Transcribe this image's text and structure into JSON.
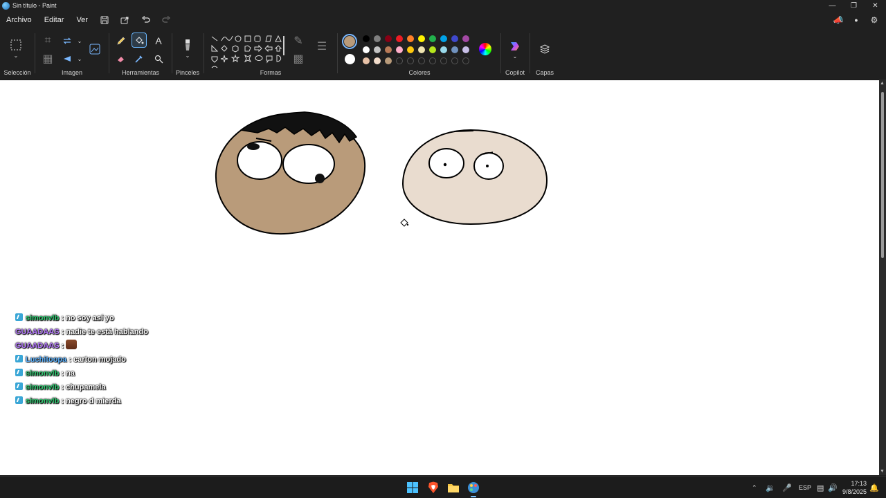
{
  "window": {
    "title": "Sin título - Paint"
  },
  "menu": {
    "items": [
      "Archivo",
      "Editar",
      "Ver"
    ]
  },
  "ribbon": {
    "groups": {
      "seleccion": "Selección",
      "imagen": "Imagen",
      "herramientas": "Herramientas",
      "pinceles": "Pinceles",
      "formas": "Formas",
      "colores": "Colores",
      "copilot": "Copilot",
      "capas": "Capas"
    },
    "active_tool": "fill-bucket",
    "color1": "#b99b7a",
    "color2": "#ffffff",
    "palette_row1": [
      "#000000",
      "#7f7f7f",
      "#880015",
      "#ed1c24",
      "#ff7f27",
      "#fff200",
      "#22b14c",
      "#00a2e8",
      "#3f48cc",
      "#a349a4"
    ],
    "palette_row2": [
      "#ffffff",
      "#c3c3c3",
      "#b97a57",
      "#ffaec9",
      "#ffc90e",
      "#efe4b0",
      "#b5e61d",
      "#99d9ea",
      "#7092be",
      "#c8bfe7"
    ],
    "palette_row3": [
      "#e8c2a8",
      "#f2dccb",
      "#b99b7a"
    ]
  },
  "chat": {
    "messages": [
      {
        "user": "simonvlb",
        "user_color": "green",
        "text": ": no soy así yo",
        "badge": true
      },
      {
        "user": "GUAADAAS",
        "user_color": "purple",
        "text": ": nadie te está hablando",
        "badge": false
      },
      {
        "user": "GUAADAAS",
        "user_color": "purple",
        "text": ":",
        "badge": false,
        "emote": true
      },
      {
        "user": "Luchitoopa",
        "user_color": "blue",
        "text": ": carton mojado",
        "badge": true
      },
      {
        "user": "simonvlb",
        "user_color": "green",
        "text": ": na",
        "badge": true
      },
      {
        "user": "simonvlb",
        "user_color": "green",
        "text": ": chupamela",
        "badge": true
      },
      {
        "user": "simonvlb",
        "user_color": "green",
        "text": ": negro d mierda",
        "badge": true
      }
    ]
  },
  "taskbar": {
    "language": "ESP",
    "time": "17:13",
    "date": "9/8/2025"
  }
}
